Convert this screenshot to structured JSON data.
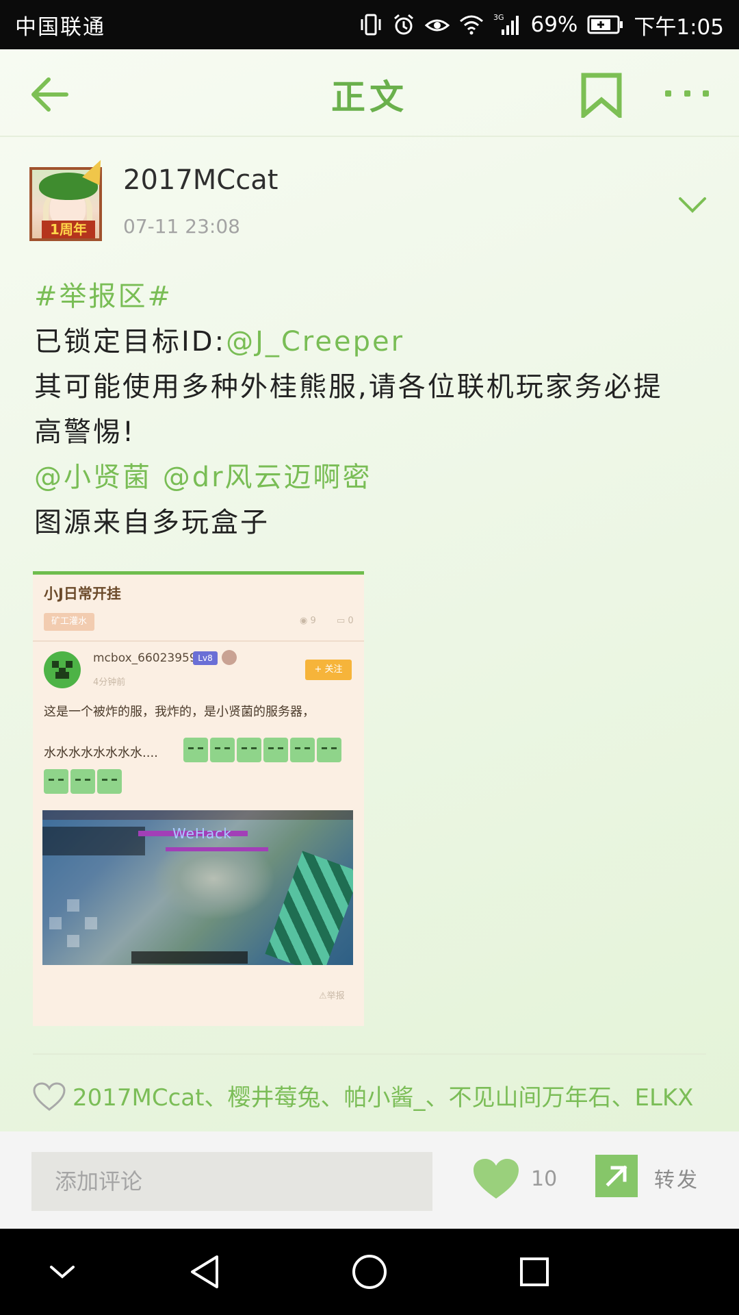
{
  "status_bar": {
    "carrier": "中国联通",
    "network": "3G",
    "battery": "69%",
    "time": "下午1:05"
  },
  "nav": {
    "title": "正文"
  },
  "post": {
    "author": "2017MCcat",
    "avatar_badge": "1周年",
    "timestamp": "07-11 23:08",
    "topic": "#举报区#",
    "line2_prefix": "已锁定目标ID:",
    "line2_mention": "@J_Creeper",
    "line3": "其可能使用多种外桂熊服,请各位联机玩家务必提",
    "line4": "高警惕!",
    "mentions": "@小贤菌 @dr风云迈啊密",
    "source": "图源来自多玩盒子"
  },
  "image": {
    "title": "小J日常开挂",
    "tag": "矿工灌水",
    "views": "9",
    "comments": "0",
    "user": "mcbox_66023959",
    "level": "Lv8",
    "ago": "4分钟前",
    "follow": "+ 关注",
    "text1": "这是一个被炸的服，我炸的，是小贤菌的服务器，",
    "text2": "水水水水水水水水....",
    "game_label": "WeHack",
    "report": "举报"
  },
  "likes": {
    "names": "2017MCcat、樱井莓兔、帕小酱_、不见山间万年石、ELKX"
  },
  "actions": {
    "comment_placeholder": "添加评论",
    "like_count": "10",
    "share_label": "转发"
  },
  "colors": {
    "accent": "#79bd55",
    "title_green": "#6ab04c",
    "share_green": "#86c669",
    "like_green": "#9ad07c"
  }
}
